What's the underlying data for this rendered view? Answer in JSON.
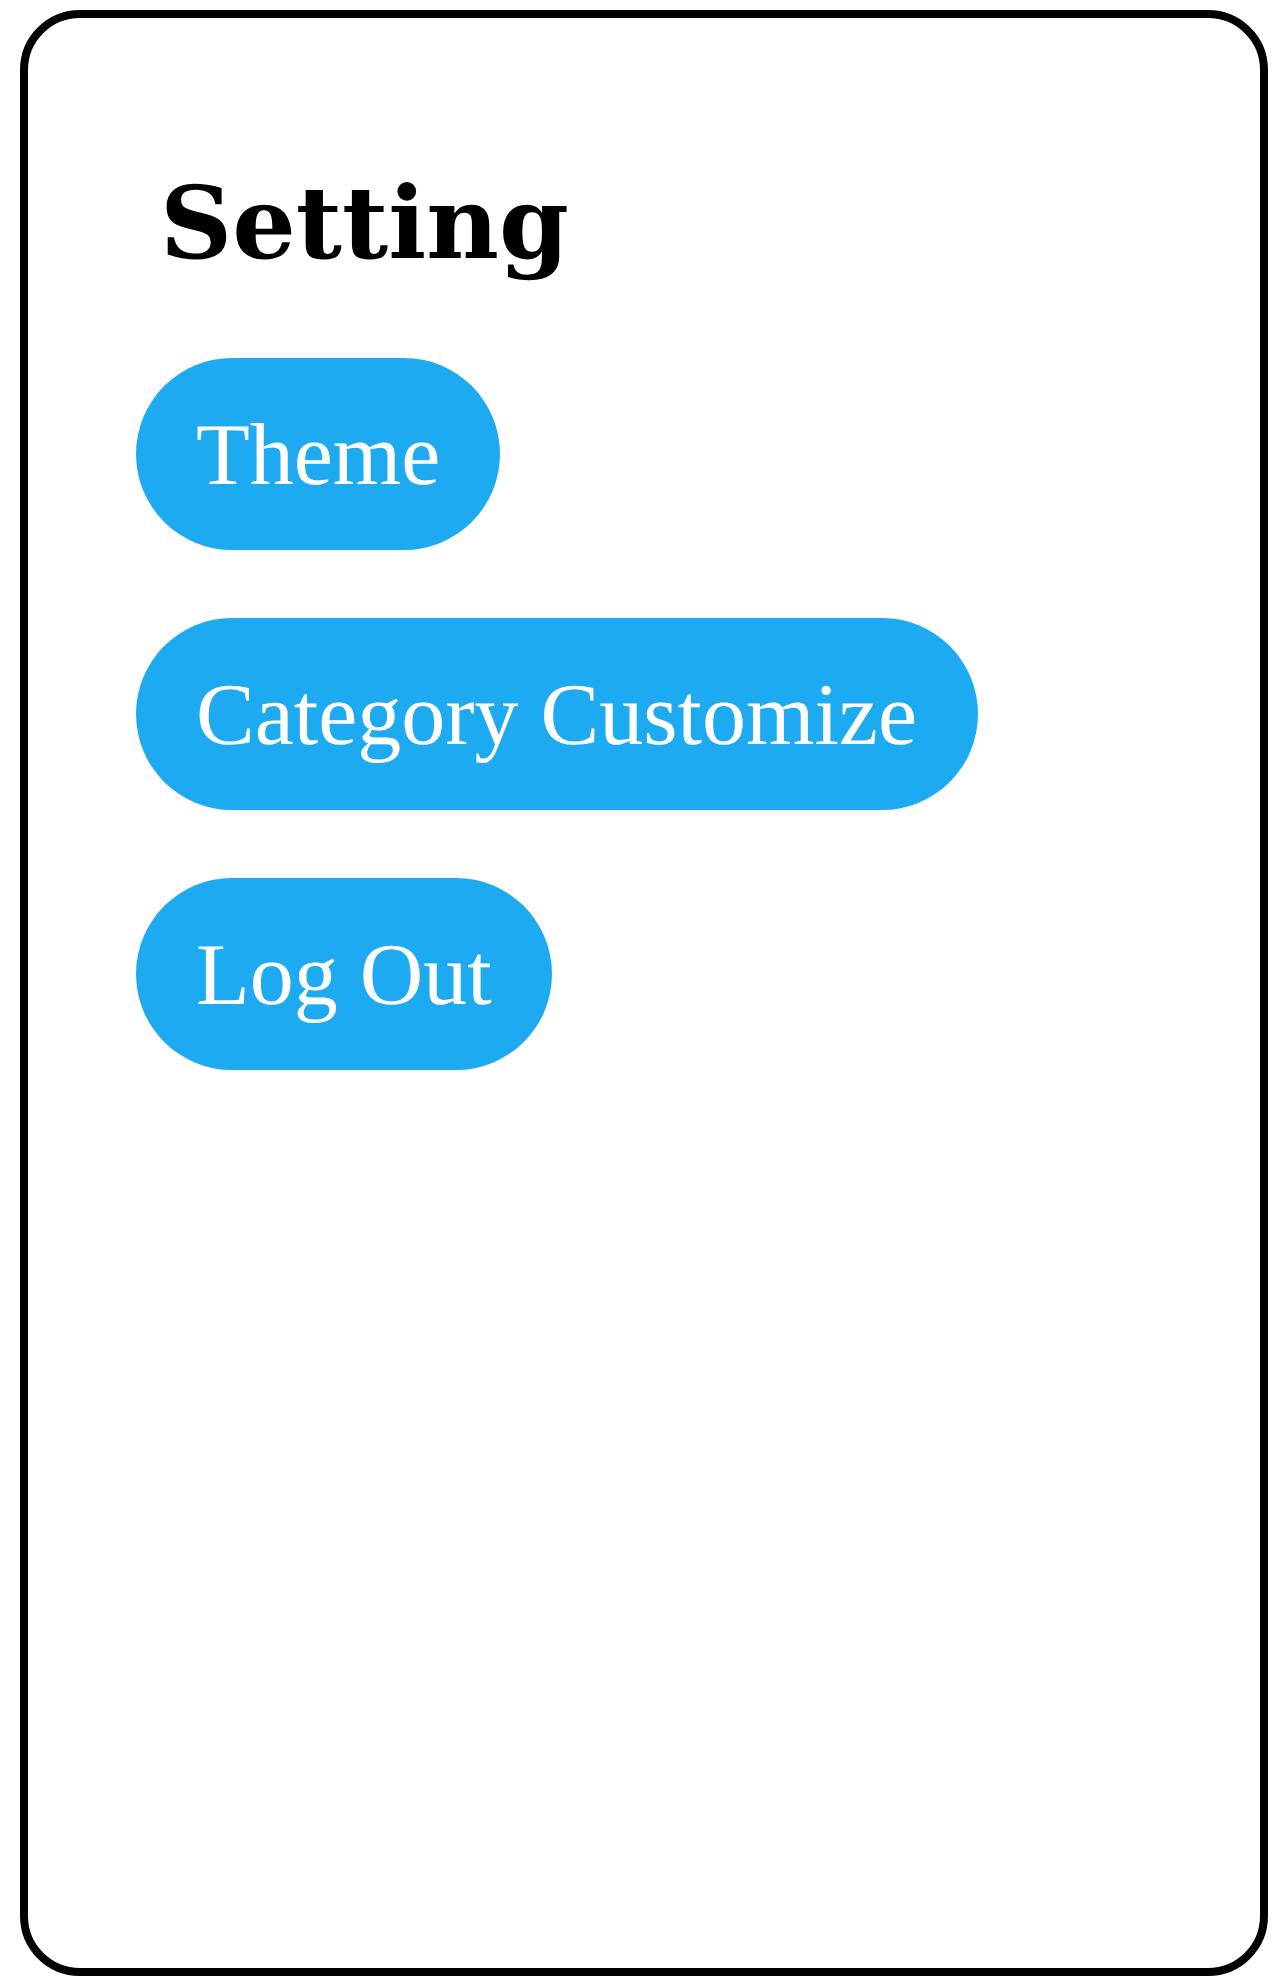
{
  "title": "Setting",
  "buttons": [
    {
      "label": "Theme"
    },
    {
      "label": "Category Customize"
    },
    {
      "label": "Log Out"
    }
  ]
}
